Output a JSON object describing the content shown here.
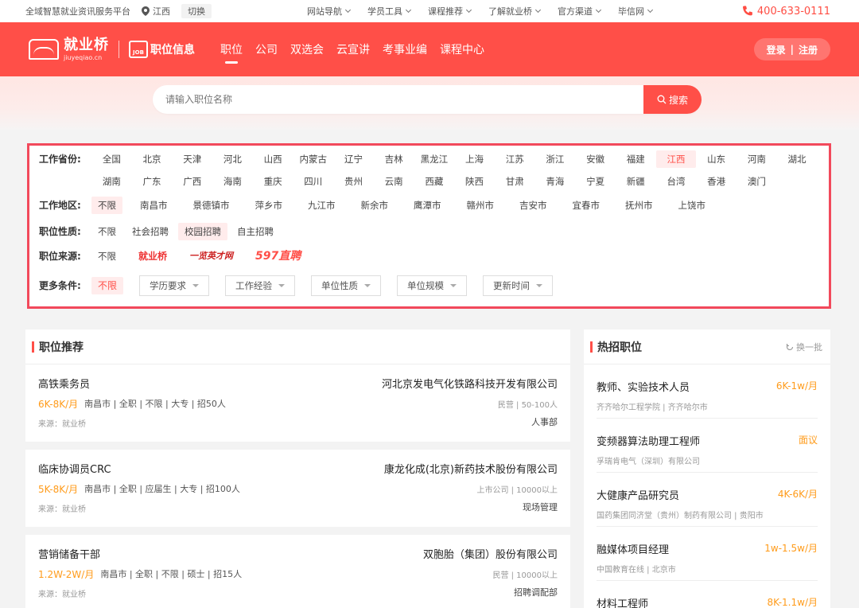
{
  "topbar": {
    "slogan": "全域智慧就业资讯服务平台",
    "city": "江西",
    "switch": "切换",
    "nav": [
      "网站导航",
      "学员工具",
      "课程推荐",
      "了解就业桥",
      "官方渠道",
      "毕信网"
    ],
    "phone": "400-633-0111"
  },
  "header": {
    "logo_cn": "就业桥",
    "logo_en": "jiuyeqiao.cn",
    "job_badge": "JOB",
    "logo2": "职位信息",
    "nav": [
      "职位",
      "公司",
      "双选会",
      "云宣讲",
      "考事业编",
      "课程中心"
    ],
    "login": "登录",
    "register": "注册"
  },
  "search": {
    "placeholder": "请输入职位名称",
    "button": "搜索"
  },
  "filters": {
    "province_label": "工作省份:",
    "provinces": [
      "全国",
      "北京",
      "天津",
      "河北",
      "山西",
      "内蒙古",
      "辽宁",
      "吉林",
      "黑龙江",
      "上海",
      "江苏",
      "浙江",
      "安徽",
      "福建",
      "江西",
      "山东",
      "河南",
      "湖北",
      "湖南",
      "广东",
      "广西",
      "海南",
      "重庆",
      "四川",
      "贵州",
      "云南",
      "西藏",
      "陕西",
      "甘肃",
      "青海",
      "宁夏",
      "新疆",
      "台湾",
      "香港",
      "澳门"
    ],
    "province_selected": 14,
    "area_label": "工作地区:",
    "areas": [
      "不限",
      "南昌市",
      "景德镇市",
      "萍乡市",
      "九江市",
      "新余市",
      "鹰潭市",
      "赣州市",
      "吉安市",
      "宜春市",
      "抚州市",
      "上饶市"
    ],
    "nature_label": "职位性质:",
    "natures": [
      "不限",
      "社会招聘",
      "校园招聘",
      "自主招聘"
    ],
    "source_label": "职位来源:",
    "source_all": "不限",
    "source_logos": [
      "就业桥",
      "一览英才网",
      "597直聘"
    ],
    "more_label": "更多条件:",
    "more_all": "不限",
    "dropdowns": [
      "学历要求",
      "工作经验",
      "单位性质",
      "单位规模",
      "更新时间"
    ]
  },
  "recommend": {
    "title": "职位推荐",
    "jobs": [
      {
        "title": "高铁乘务员",
        "salary": "6K-8K/月",
        "meta": "南昌市 | 全职 | 不限 | 大专 | 招50人",
        "source": "来源：就业桥",
        "company": "河北京发电气化铁路科技开发有限公司",
        "coinfo": "民营 | 50-100人",
        "dept": "人事部"
      },
      {
        "title": "临床协调员CRC",
        "salary": "5K-8K/月",
        "meta": "南昌市 | 全职 | 应届生 | 大专 | 招100人",
        "source": "来源：就业桥",
        "company": "康龙化成(北京)新药技术股份有限公司",
        "coinfo": "上市公司 | 10000以上",
        "dept": "现场管理"
      },
      {
        "title": "营销储备干部",
        "salary": "1.2W-2W/月",
        "meta": "南昌市 | 全职 | 不限 | 硕士 | 招15人",
        "source": "来源：就业桥",
        "company": "双胞胎（集团）股份有限公司",
        "coinfo": "民营 | 10000以上",
        "dept": "招聘调配部"
      }
    ]
  },
  "hot": {
    "title": "热招职位",
    "refresh": "换一批",
    "jobs": [
      {
        "title": "教师、实验技术人员",
        "company": "齐齐哈尔工程学院 | 齐齐哈尔市",
        "salary": "6K-1w/月"
      },
      {
        "title": "变频器算法助理工程师",
        "company": "孚瑞肯电气（深圳）有限公司",
        "salary": "面议"
      },
      {
        "title": "大健康产品研究员",
        "company": "国药集团同济堂（贵州）制药有限公司 | 贵阳市",
        "salary": "4K-6K/月"
      },
      {
        "title": "融媒体项目经理",
        "company": "中国教育在线 | 北京市",
        "salary": "1w-1.5w/月"
      },
      {
        "title": "材料工程师",
        "company": "",
        "salary": "8K-1.1w/月"
      }
    ]
  },
  "colors": {
    "brand": "#ff4f48",
    "salary": "#ff9b1a",
    "filter_border": "#f2495b"
  }
}
